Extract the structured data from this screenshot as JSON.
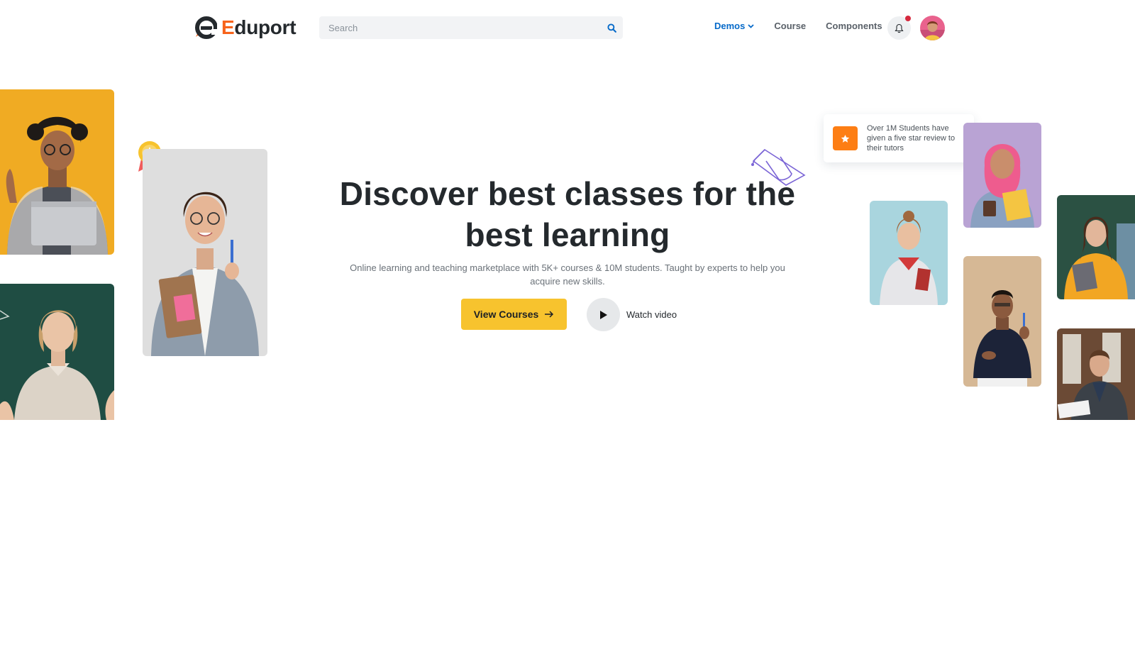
{
  "header": {
    "logo": {
      "text_main": "duport",
      "text_accent": "E"
    },
    "search": {
      "placeholder": "Search"
    },
    "nav": [
      {
        "label": "Demos",
        "active": true,
        "has_dropdown": true
      },
      {
        "label": "Course",
        "active": false
      },
      {
        "label": "Components",
        "active": false
      }
    ],
    "notification": {
      "icon": "bell-icon",
      "has_unread": true
    }
  },
  "hero": {
    "title_line1": "Discover best classes for the",
    "title_line2": "best learning",
    "subtitle": "Online learning and teaching marketplace with 5K+ courses & 10M students. Taught by experts to help you acquire new skills.",
    "cta_label": "View Courses",
    "video_label": "Watch video"
  },
  "review_card": {
    "icon": "star-icon",
    "text": "Over 1M Students have given a five star review to their tutors"
  },
  "colors": {
    "accent_orange": "#f7631b",
    "primary_blue": "#066ac9",
    "cta_yellow": "#f7c32e",
    "notification_red": "#d6293e"
  }
}
